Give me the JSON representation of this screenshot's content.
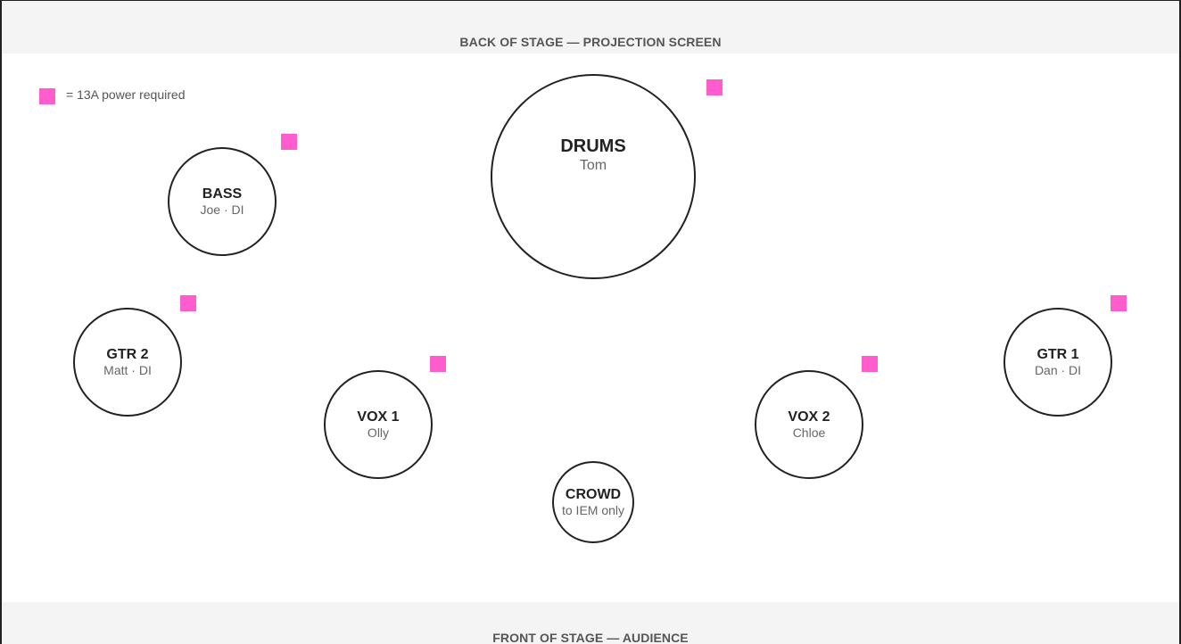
{
  "labels": {
    "back": "BACK OF STAGE — PROJECTION SCREEN",
    "front": "FRONT OF STAGE — AUDIENCE"
  },
  "legend": {
    "text": "= 13A power required",
    "color": "#ff5ccd"
  },
  "positions": {
    "drums": {
      "name": "DRUMS",
      "sub": "Tom"
    },
    "bass": {
      "name": "BASS",
      "sub": "Joe · DI"
    },
    "gtr2": {
      "name": "GTR 2",
      "sub": "Matt · DI"
    },
    "vox1": {
      "name": "VOX 1",
      "sub": "Olly"
    },
    "crowd": {
      "name": "CROWD",
      "sub": "to IEM only"
    },
    "vox2": {
      "name": "VOX 2",
      "sub": "Chloe"
    },
    "gtr1": {
      "name": "GTR 1",
      "sub": "Dan · DI"
    }
  }
}
